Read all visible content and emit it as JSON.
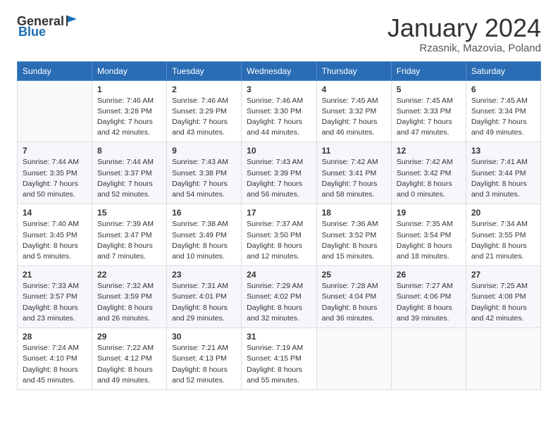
{
  "header": {
    "logo_general": "General",
    "logo_blue": "Blue",
    "month_title": "January 2024",
    "location": "Rzasnik, Mazovia, Poland"
  },
  "days_of_week": [
    "Sunday",
    "Monday",
    "Tuesday",
    "Wednesday",
    "Thursday",
    "Friday",
    "Saturday"
  ],
  "weeks": [
    [
      {
        "day": "",
        "content": ""
      },
      {
        "day": "1",
        "content": "Sunrise: 7:46 AM\nSunset: 3:28 PM\nDaylight: 7 hours\nand 42 minutes."
      },
      {
        "day": "2",
        "content": "Sunrise: 7:46 AM\nSunset: 3:29 PM\nDaylight: 7 hours\nand 43 minutes."
      },
      {
        "day": "3",
        "content": "Sunrise: 7:46 AM\nSunset: 3:30 PM\nDaylight: 7 hours\nand 44 minutes."
      },
      {
        "day": "4",
        "content": "Sunrise: 7:45 AM\nSunset: 3:32 PM\nDaylight: 7 hours\nand 46 minutes."
      },
      {
        "day": "5",
        "content": "Sunrise: 7:45 AM\nSunset: 3:33 PM\nDaylight: 7 hours\nand 47 minutes."
      },
      {
        "day": "6",
        "content": "Sunrise: 7:45 AM\nSunset: 3:34 PM\nDaylight: 7 hours\nand 49 minutes."
      }
    ],
    [
      {
        "day": "7",
        "content": "Sunrise: 7:44 AM\nSunset: 3:35 PM\nDaylight: 7 hours\nand 50 minutes."
      },
      {
        "day": "8",
        "content": "Sunrise: 7:44 AM\nSunset: 3:37 PM\nDaylight: 7 hours\nand 52 minutes."
      },
      {
        "day": "9",
        "content": "Sunrise: 7:43 AM\nSunset: 3:38 PM\nDaylight: 7 hours\nand 54 minutes."
      },
      {
        "day": "10",
        "content": "Sunrise: 7:43 AM\nSunset: 3:39 PM\nDaylight: 7 hours\nand 56 minutes."
      },
      {
        "day": "11",
        "content": "Sunrise: 7:42 AM\nSunset: 3:41 PM\nDaylight: 7 hours\nand 58 minutes."
      },
      {
        "day": "12",
        "content": "Sunrise: 7:42 AM\nSunset: 3:42 PM\nDaylight: 8 hours\nand 0 minutes."
      },
      {
        "day": "13",
        "content": "Sunrise: 7:41 AM\nSunset: 3:44 PM\nDaylight: 8 hours\nand 3 minutes."
      }
    ],
    [
      {
        "day": "14",
        "content": "Sunrise: 7:40 AM\nSunset: 3:45 PM\nDaylight: 8 hours\nand 5 minutes."
      },
      {
        "day": "15",
        "content": "Sunrise: 7:39 AM\nSunset: 3:47 PM\nDaylight: 8 hours\nand 7 minutes."
      },
      {
        "day": "16",
        "content": "Sunrise: 7:38 AM\nSunset: 3:49 PM\nDaylight: 8 hours\nand 10 minutes."
      },
      {
        "day": "17",
        "content": "Sunrise: 7:37 AM\nSunset: 3:50 PM\nDaylight: 8 hours\nand 12 minutes."
      },
      {
        "day": "18",
        "content": "Sunrise: 7:36 AM\nSunset: 3:52 PM\nDaylight: 8 hours\nand 15 minutes."
      },
      {
        "day": "19",
        "content": "Sunrise: 7:35 AM\nSunset: 3:54 PM\nDaylight: 8 hours\nand 18 minutes."
      },
      {
        "day": "20",
        "content": "Sunrise: 7:34 AM\nSunset: 3:55 PM\nDaylight: 8 hours\nand 21 minutes."
      }
    ],
    [
      {
        "day": "21",
        "content": "Sunrise: 7:33 AM\nSunset: 3:57 PM\nDaylight: 8 hours\nand 23 minutes."
      },
      {
        "day": "22",
        "content": "Sunrise: 7:32 AM\nSunset: 3:59 PM\nDaylight: 8 hours\nand 26 minutes."
      },
      {
        "day": "23",
        "content": "Sunrise: 7:31 AM\nSunset: 4:01 PM\nDaylight: 8 hours\nand 29 minutes."
      },
      {
        "day": "24",
        "content": "Sunrise: 7:29 AM\nSunset: 4:02 PM\nDaylight: 8 hours\nand 32 minutes."
      },
      {
        "day": "25",
        "content": "Sunrise: 7:28 AM\nSunset: 4:04 PM\nDaylight: 8 hours\nand 36 minutes."
      },
      {
        "day": "26",
        "content": "Sunrise: 7:27 AM\nSunset: 4:06 PM\nDaylight: 8 hours\nand 39 minutes."
      },
      {
        "day": "27",
        "content": "Sunrise: 7:25 AM\nSunset: 4:08 PM\nDaylight: 8 hours\nand 42 minutes."
      }
    ],
    [
      {
        "day": "28",
        "content": "Sunrise: 7:24 AM\nSunset: 4:10 PM\nDaylight: 8 hours\nand 45 minutes."
      },
      {
        "day": "29",
        "content": "Sunrise: 7:22 AM\nSunset: 4:12 PM\nDaylight: 8 hours\nand 49 minutes."
      },
      {
        "day": "30",
        "content": "Sunrise: 7:21 AM\nSunset: 4:13 PM\nDaylight: 8 hours\nand 52 minutes."
      },
      {
        "day": "31",
        "content": "Sunrise: 7:19 AM\nSunset: 4:15 PM\nDaylight: 8 hours\nand 55 minutes."
      },
      {
        "day": "",
        "content": ""
      },
      {
        "day": "",
        "content": ""
      },
      {
        "day": "",
        "content": ""
      }
    ]
  ]
}
